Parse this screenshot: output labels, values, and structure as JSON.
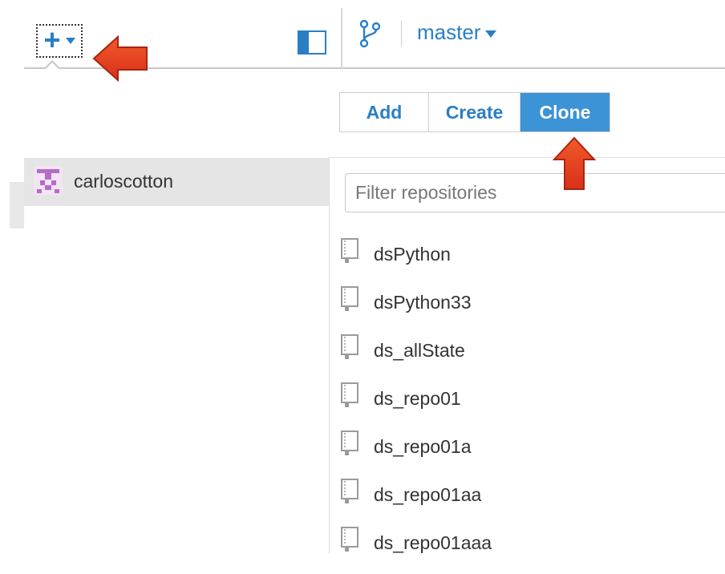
{
  "toolbar": {
    "add_icon": "plus-icon",
    "dropdown_icon": "chevron-down-icon",
    "panel_icon": "panel-toggle-icon",
    "branch_icon": "git-branch-icon",
    "branch_name": "master"
  },
  "tabs": [
    {
      "label": "Add",
      "active": false
    },
    {
      "label": "Create",
      "active": false
    },
    {
      "label": "Clone",
      "active": true
    }
  ],
  "accounts": [
    {
      "name": "carloscotton",
      "avatar": "identicon-avatar",
      "selected": true
    }
  ],
  "filter": {
    "placeholder": "Filter repositories",
    "value": ""
  },
  "repositories": [
    {
      "name": "dsPython",
      "icon": "repo-icon"
    },
    {
      "name": "dsPython33",
      "icon": "repo-icon"
    },
    {
      "name": "ds_allState",
      "icon": "repo-icon"
    },
    {
      "name": "ds_repo01",
      "icon": "repo-icon"
    },
    {
      "name": "ds_repo01a",
      "icon": "repo-icon"
    },
    {
      "name": "ds_repo01aa",
      "icon": "repo-icon"
    },
    {
      "name": "ds_repo01aaa",
      "icon": "repo-icon"
    }
  ],
  "colors": {
    "accent": "#2a7fc4",
    "active_tab": "#3c93d6",
    "annotation_arrow": "#e8401c",
    "selected_row": "#e5e5e5"
  }
}
